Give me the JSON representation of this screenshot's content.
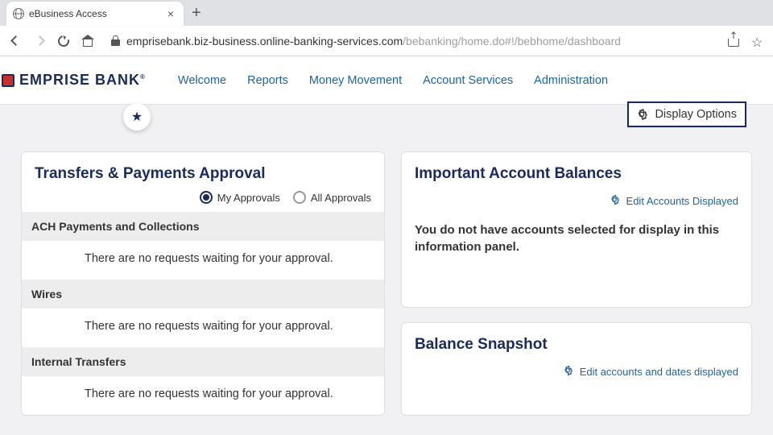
{
  "browser": {
    "tab_title": "eBusiness Access",
    "url_domain": "emprisebank.biz-business.online-banking-services.com",
    "url_path": "/bebanking/home.do#!/bebhome/dashboard"
  },
  "logo": {
    "text": "EMPRISE BANK"
  },
  "nav": {
    "items": [
      "Welcome",
      "Reports",
      "Money Movement",
      "Account Services",
      "Administration"
    ]
  },
  "display_options_label": "Display Options",
  "left_card": {
    "title": "Transfers & Payments Approval",
    "toggle": {
      "my": "My Approvals",
      "all": "All Approvals"
    },
    "sections": [
      {
        "header": "ACH Payments and Collections",
        "msg": "There are no requests waiting for your approval."
      },
      {
        "header": "Wires",
        "msg": "There are no requests waiting for your approval."
      },
      {
        "header": "Internal Transfers",
        "msg": "There are no requests waiting for your approval."
      }
    ]
  },
  "balances_card": {
    "title": "Important Account Balances",
    "edit_label": "Edit Accounts Displayed",
    "msg": "You do not have accounts selected for display in this information panel."
  },
  "snapshot_card": {
    "title": "Balance Snapshot",
    "edit_label": "Edit accounts and dates displayed"
  }
}
